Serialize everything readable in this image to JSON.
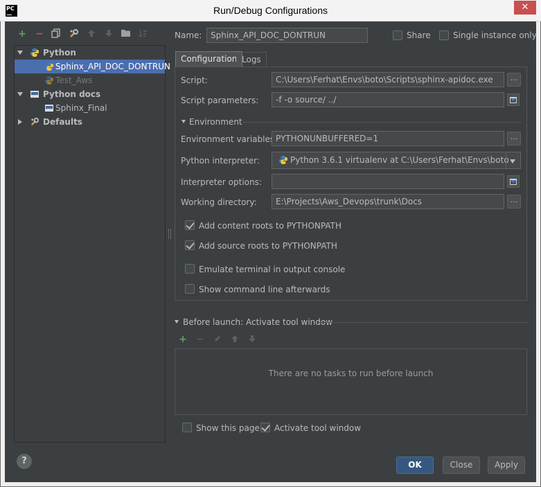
{
  "window": {
    "title": "Run/Debug Configurations",
    "close_glyph": "✕"
  },
  "toolbar": {
    "add_glyph": "+",
    "remove_glyph": "−"
  },
  "tree": {
    "python": {
      "label": "Python"
    },
    "sphinx_api": {
      "label": "Sphinx_API_DOC_DONTRUN"
    },
    "test_aws": {
      "label": "Test_Aws"
    },
    "python_docs": {
      "label": "Python docs"
    },
    "sphinx_final": {
      "label": "Sphinx_Final"
    },
    "defaults": {
      "label": "Defaults"
    }
  },
  "header": {
    "name_label": "Name:",
    "name_value": "Sphinx_API_DOC_DONTRUN",
    "share_label": "Share",
    "single_instance_label": "Single instance only"
  },
  "tabs": [
    {
      "label": "Configuration"
    },
    {
      "label": "Logs"
    }
  ],
  "config": {
    "script_label": "Script:",
    "script_value": "C:\\Users\\Ferhat\\Envs\\boto\\Scripts\\sphinx-apidoc.exe",
    "script_params_label": "Script parameters:",
    "script_params_value": "-f -o source/ ../",
    "environment_label": "Environment",
    "env_vars_label": "Environment variables:",
    "env_vars_value": "PYTHONUNBUFFERED=1",
    "interpreter_label": "Python interpreter:",
    "interpreter_value": "Python 3.6.1 virtualenv at C:\\Users\\Ferhat\\Envs\\boto",
    "interpreter_options_label": "Interpreter options:",
    "interpreter_options_value": "",
    "working_dir_label": "Working directory:",
    "working_dir_value": "E:\\Projects\\Aws_Devops\\trunk\\Docs",
    "add_content_roots_label": "Add content roots to PYTHONPATH",
    "add_content_roots_checked": true,
    "add_source_roots_label": "Add source roots to PYTHONPATH",
    "add_source_roots_checked": true,
    "emulate_terminal_label": "Emulate terminal in output console",
    "emulate_terminal_checked": false,
    "show_cmd_label": "Show command line afterwards",
    "show_cmd_checked": false,
    "dots_glyph": "..."
  },
  "before_launch": {
    "title": "Before launch: Activate tool window",
    "empty_text": "There are no tasks to run before launch",
    "show_page_label": "Show this page",
    "show_page_checked": false,
    "activate_tool_label": "Activate tool window",
    "activate_tool_checked": true
  },
  "buttons": {
    "ok": "OK",
    "close": "Close",
    "apply": "Apply",
    "help": "?"
  },
  "colors": {
    "accent": "#4b6eaf",
    "background": "#3c3f41",
    "field": "#45494a",
    "green_plus": "#59a869",
    "red_minus": "#c75450"
  }
}
